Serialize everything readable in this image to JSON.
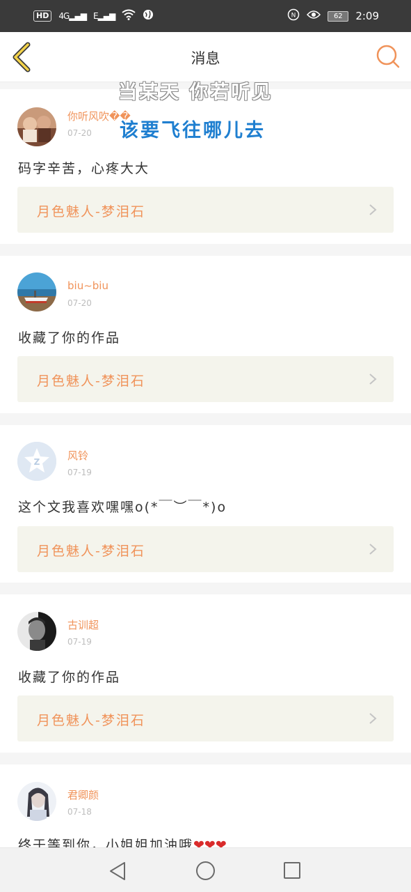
{
  "status_bar": {
    "hd": "HD",
    "network": "4G",
    "network2": "E",
    "battery": "62",
    "time": "2:09",
    "icons": [
      "signal-icon",
      "wifi-icon",
      "globe-icon",
      "nfc-icon",
      "eye-icon",
      "battery-icon"
    ]
  },
  "header": {
    "title": "消息",
    "back_icon": "chevron-left-icon",
    "search_icon": "search-icon",
    "accent_color": "#f0935a"
  },
  "overlay": {
    "line1": "当某天 你若听见",
    "line2": "该要飞往哪儿去"
  },
  "messages": [
    {
      "name": "你听风吹��",
      "date": "07-20",
      "text": "码字辛苦，心疼大大",
      "work": "月色魅人-梦泪石"
    },
    {
      "name": "biu~biu",
      "date": "07-20",
      "text": "收藏了你的作品",
      "work": "月色魅人-梦泪石"
    },
    {
      "name": "风铃",
      "date": "07-19",
      "text": "这个文我喜欢嘿嘿o(*￣︶￣*)o",
      "work": "月色魅人-梦泪石"
    },
    {
      "name": "古训超",
      "date": "07-19",
      "text": "收藏了你的作品",
      "work": "月色魅人-梦泪石"
    },
    {
      "name": "君卿颜",
      "date": "07-18",
      "text": "终于等到你，小姐姐加油哦",
      "hearts": "❤❤❤"
    }
  ],
  "nav": {
    "icons": [
      "back-triangle-icon",
      "home-circle-icon",
      "recents-square-icon"
    ]
  }
}
